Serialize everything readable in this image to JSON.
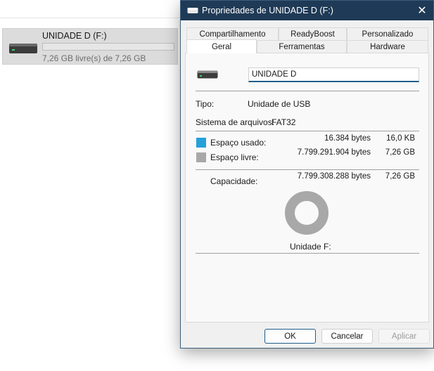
{
  "explorer": {
    "drive_name": "UNIDADE D (F:)",
    "drive_space": "7,26 GB livre(s) de 7,26 GB",
    "usage_fraction": 0.0
  },
  "dialog": {
    "title": "Propriedades de UNIDADE D (F:)",
    "tabs_back": [
      "Compartilhamento",
      "ReadyBoost",
      "Personalizado"
    ],
    "tabs_front": [
      "Geral",
      "Ferramentas",
      "Hardware"
    ],
    "active_tab": "Geral",
    "volume_label": "UNIDADE D",
    "type_label": "Tipo:",
    "type_value": "Unidade de USB",
    "fs_label": "Sistema de arquivos:",
    "fs_value": "FAT32",
    "used_label": "Espaço usado:",
    "used_bytes": "16.384 bytes",
    "used_size": "16,0 KB",
    "free_label": "Espaço livre:",
    "free_bytes": "7.799.291.904 bytes",
    "free_size": "7,26 GB",
    "capacity_label": "Capacidade:",
    "capacity_bytes": "7.799.308.288 bytes",
    "capacity_size": "7,26 GB",
    "drive_caption": "Unidade F:",
    "buttons": {
      "ok": "OK",
      "cancel": "Cancelar",
      "apply": "Aplicar"
    },
    "colors": {
      "used": "#26a0da",
      "free": "#a8a8a8",
      "titlebar": "#1f3a56"
    }
  }
}
